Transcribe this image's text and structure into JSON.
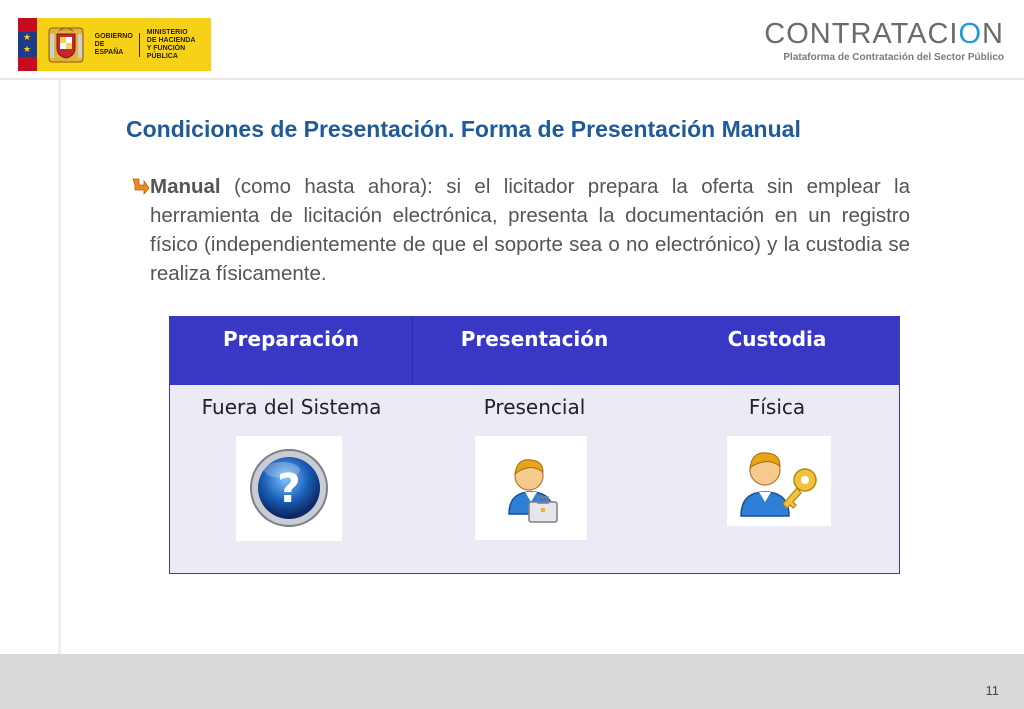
{
  "header": {
    "gov_logo": {
      "line1": "GOBIERNO\nDE ESPAÑA",
      "line2": "MINISTERIO\nDE HACIENDA\nY FUNCIÓN PÚBLICA"
    },
    "brand": {
      "word_main": "CONTRATACI",
      "word_accent": "O",
      "word_tail": "N",
      "subtitle": "Plataforma de Contratación del Sector Público"
    }
  },
  "slide": {
    "title": "Condiciones de Presentación. Forma de Presentación Manual",
    "bullet": {
      "lead": "Manual",
      "text": " (como hasta ahora): si el licitador prepara la oferta sin emplear la herramienta de licitación electrónica, presenta la documentación en un registro físico (independientemente de que el soporte sea o no electrónico) y la custodia se realiza físicamente."
    }
  },
  "table": {
    "headers": [
      "Preparación",
      "Presentación",
      "Custodia"
    ],
    "values": [
      "Fuera del Sistema",
      "Presencial",
      "Física"
    ],
    "icons": [
      "question-icon",
      "user-briefcase-icon",
      "user-key-icon"
    ]
  },
  "footer": {
    "page_number": "11"
  },
  "colors": {
    "title": "#1f5a9a",
    "table_header": "#3838c4",
    "table_body": "#ebeaf5",
    "brand_accent": "#1a9ad6"
  }
}
